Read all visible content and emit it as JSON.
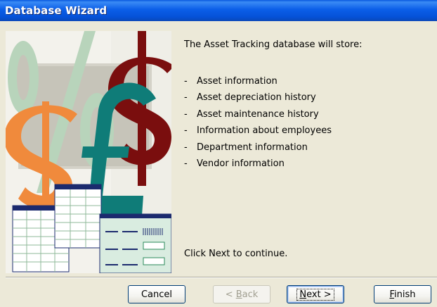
{
  "window": {
    "title": "Database Wizard",
    "accent": "#0a58e0"
  },
  "content": {
    "intro": "The Asset Tracking database will store:",
    "items": [
      {
        "bullet": "-",
        "text": "Asset information"
      },
      {
        "bullet": "-",
        "text": "Asset depreciation history"
      },
      {
        "bullet": "-",
        "text": "Asset maintenance history"
      },
      {
        "bullet": "-",
        "text": "Information about employees"
      },
      {
        "bullet": "-",
        "text": "Department information"
      },
      {
        "bullet": "-",
        "text": "Vendor information"
      }
    ],
    "footer": "Click Next to continue."
  },
  "illustration": {
    "icons": [
      "percent-sign-icon",
      "dollar-sign-icon",
      "pound-sign-icon",
      "spreadsheet-icon",
      "form-icon"
    ],
    "symbols": [
      "%",
      "$",
      "$",
      "£"
    ]
  },
  "buttons": {
    "cancel": {
      "label": "Cancel",
      "enabled": true
    },
    "back": {
      "pre": "< ",
      "mnemonic": "B",
      "rest": "ack",
      "enabled": false
    },
    "next": {
      "pre": "",
      "mnemonic": "N",
      "rest": "ext >",
      "enabled": true,
      "default": true
    },
    "finish": {
      "pre": "",
      "mnemonic": "F",
      "rest": "inish",
      "enabled": true
    }
  }
}
